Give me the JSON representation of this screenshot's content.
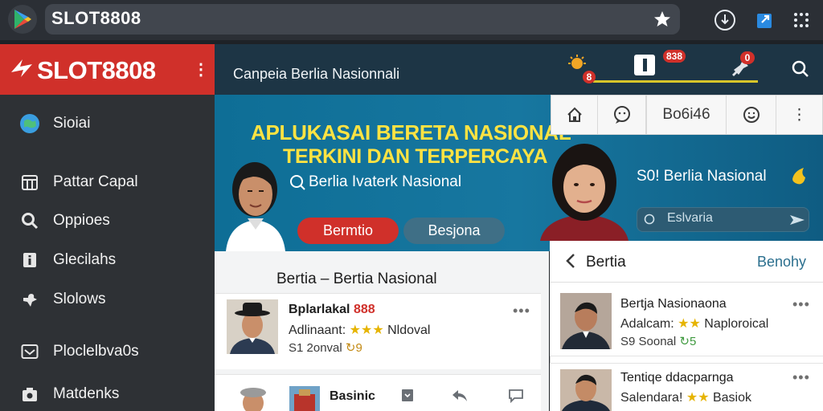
{
  "browser": {
    "url_title": "SLOT8808"
  },
  "sidebar": {
    "brand": "SLOT8808",
    "items": [
      {
        "label": "Sioiai",
        "icon": "globe-icon"
      },
      {
        "label": "Pattar Capal",
        "icon": "calendar-icon"
      },
      {
        "label": "Oppioes",
        "icon": "search-icon"
      },
      {
        "label": "Glecilahs",
        "icon": "info-icon"
      },
      {
        "label": "Slolows",
        "icon": "puzzle-icon"
      },
      {
        "label": "Ploclelbva0s",
        "icon": "image-icon"
      },
      {
        "label": "Matdenks",
        "icon": "camera-icon"
      }
    ]
  },
  "header": {
    "title": "Canpeia Berlia Nasionnali",
    "badge1": "8",
    "badge2": "838",
    "badge3": "0"
  },
  "banner": {
    "title_line1": "APLUKASAI BERETA NASIONAL",
    "title_line2": "TERKINI DAN TERPERCAYA",
    "subtitle": "Berlia Ivaterk Nasional",
    "button_primary": "Bermtio",
    "button_secondary": "Besjona",
    "right_text": "S0! Berlia Nasional",
    "search_text": "Eslvaria"
  },
  "right_toolbar": {
    "center_label": "Bo6i46"
  },
  "section": {
    "title": "Bertia – Bertia Nasional"
  },
  "cards": [
    {
      "title": "Bplarlakal ",
      "title_accent": "888",
      "line2_prefix": "Adlinaant:",
      "line2_stars": "★★★",
      "line2_suffix": "Nldoval",
      "line3_prefix": "S1 2onval",
      "line3_accent": "↻9"
    },
    {
      "title": "Basinic"
    }
  ],
  "right_panel": {
    "back_label": "Bertia",
    "right_label": "Benohy",
    "cards": [
      {
        "title": "Bertja Nasionaona",
        "line2_prefix": "Adalcam:",
        "line2_stars": "★★",
        "line2_suffix": "Naploroical",
        "line3_prefix": "S9 Soonal",
        "line3_accent": "↻5"
      },
      {
        "title": "Tentiqe ddacparnga",
        "line2_prefix": "Salendara!",
        "line2_stars": "★★",
        "line2_suffix": "Basiok"
      }
    ]
  },
  "colors": {
    "brand_red": "#d0302a",
    "banner_blue": "#0e6e96",
    "banner_yellow": "#ffe342",
    "sidebar_bg": "#2e3135",
    "star": "#e6b400"
  }
}
